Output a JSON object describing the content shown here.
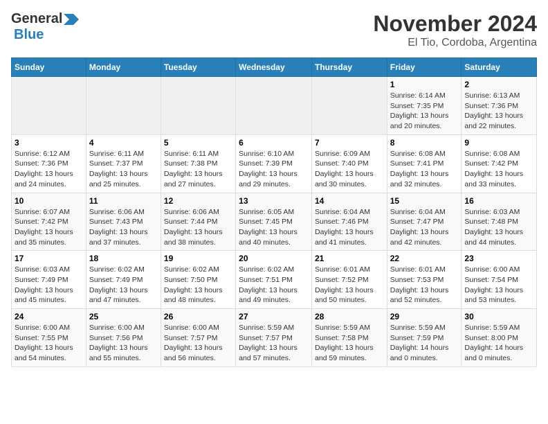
{
  "header": {
    "logo_general": "General",
    "logo_blue": "Blue",
    "month": "November 2024",
    "location": "El Tio, Cordoba, Argentina"
  },
  "weekdays": [
    "Sunday",
    "Monday",
    "Tuesday",
    "Wednesday",
    "Thursday",
    "Friday",
    "Saturday"
  ],
  "weeks": [
    [
      {
        "day": "",
        "empty": true
      },
      {
        "day": "",
        "empty": true
      },
      {
        "day": "",
        "empty": true
      },
      {
        "day": "",
        "empty": true
      },
      {
        "day": "",
        "empty": true
      },
      {
        "day": "1",
        "info": "Sunrise: 6:14 AM\nSunset: 7:35 PM\nDaylight: 13 hours\nand 20 minutes."
      },
      {
        "day": "2",
        "info": "Sunrise: 6:13 AM\nSunset: 7:36 PM\nDaylight: 13 hours\nand 22 minutes."
      }
    ],
    [
      {
        "day": "3",
        "info": "Sunrise: 6:12 AM\nSunset: 7:36 PM\nDaylight: 13 hours\nand 24 minutes."
      },
      {
        "day": "4",
        "info": "Sunrise: 6:11 AM\nSunset: 7:37 PM\nDaylight: 13 hours\nand 25 minutes."
      },
      {
        "day": "5",
        "info": "Sunrise: 6:11 AM\nSunset: 7:38 PM\nDaylight: 13 hours\nand 27 minutes."
      },
      {
        "day": "6",
        "info": "Sunrise: 6:10 AM\nSunset: 7:39 PM\nDaylight: 13 hours\nand 29 minutes."
      },
      {
        "day": "7",
        "info": "Sunrise: 6:09 AM\nSunset: 7:40 PM\nDaylight: 13 hours\nand 30 minutes."
      },
      {
        "day": "8",
        "info": "Sunrise: 6:08 AM\nSunset: 7:41 PM\nDaylight: 13 hours\nand 32 minutes."
      },
      {
        "day": "9",
        "info": "Sunrise: 6:08 AM\nSunset: 7:42 PM\nDaylight: 13 hours\nand 33 minutes."
      }
    ],
    [
      {
        "day": "10",
        "info": "Sunrise: 6:07 AM\nSunset: 7:42 PM\nDaylight: 13 hours\nand 35 minutes."
      },
      {
        "day": "11",
        "info": "Sunrise: 6:06 AM\nSunset: 7:43 PM\nDaylight: 13 hours\nand 37 minutes."
      },
      {
        "day": "12",
        "info": "Sunrise: 6:06 AM\nSunset: 7:44 PM\nDaylight: 13 hours\nand 38 minutes."
      },
      {
        "day": "13",
        "info": "Sunrise: 6:05 AM\nSunset: 7:45 PM\nDaylight: 13 hours\nand 40 minutes."
      },
      {
        "day": "14",
        "info": "Sunrise: 6:04 AM\nSunset: 7:46 PM\nDaylight: 13 hours\nand 41 minutes."
      },
      {
        "day": "15",
        "info": "Sunrise: 6:04 AM\nSunset: 7:47 PM\nDaylight: 13 hours\nand 42 minutes."
      },
      {
        "day": "16",
        "info": "Sunrise: 6:03 AM\nSunset: 7:48 PM\nDaylight: 13 hours\nand 44 minutes."
      }
    ],
    [
      {
        "day": "17",
        "info": "Sunrise: 6:03 AM\nSunset: 7:49 PM\nDaylight: 13 hours\nand 45 minutes."
      },
      {
        "day": "18",
        "info": "Sunrise: 6:02 AM\nSunset: 7:49 PM\nDaylight: 13 hours\nand 47 minutes."
      },
      {
        "day": "19",
        "info": "Sunrise: 6:02 AM\nSunset: 7:50 PM\nDaylight: 13 hours\nand 48 minutes."
      },
      {
        "day": "20",
        "info": "Sunrise: 6:02 AM\nSunset: 7:51 PM\nDaylight: 13 hours\nand 49 minutes."
      },
      {
        "day": "21",
        "info": "Sunrise: 6:01 AM\nSunset: 7:52 PM\nDaylight: 13 hours\nand 50 minutes."
      },
      {
        "day": "22",
        "info": "Sunrise: 6:01 AM\nSunset: 7:53 PM\nDaylight: 13 hours\nand 52 minutes."
      },
      {
        "day": "23",
        "info": "Sunrise: 6:00 AM\nSunset: 7:54 PM\nDaylight: 13 hours\nand 53 minutes."
      }
    ],
    [
      {
        "day": "24",
        "info": "Sunrise: 6:00 AM\nSunset: 7:55 PM\nDaylight: 13 hours\nand 54 minutes."
      },
      {
        "day": "25",
        "info": "Sunrise: 6:00 AM\nSunset: 7:56 PM\nDaylight: 13 hours\nand 55 minutes."
      },
      {
        "day": "26",
        "info": "Sunrise: 6:00 AM\nSunset: 7:57 PM\nDaylight: 13 hours\nand 56 minutes."
      },
      {
        "day": "27",
        "info": "Sunrise: 5:59 AM\nSunset: 7:57 PM\nDaylight: 13 hours\nand 57 minutes."
      },
      {
        "day": "28",
        "info": "Sunrise: 5:59 AM\nSunset: 7:58 PM\nDaylight: 13 hours\nand 59 minutes."
      },
      {
        "day": "29",
        "info": "Sunrise: 5:59 AM\nSunset: 7:59 PM\nDaylight: 14 hours\nand 0 minutes."
      },
      {
        "day": "30",
        "info": "Sunrise: 5:59 AM\nSunset: 8:00 PM\nDaylight: 14 hours\nand 0 minutes."
      }
    ]
  ]
}
